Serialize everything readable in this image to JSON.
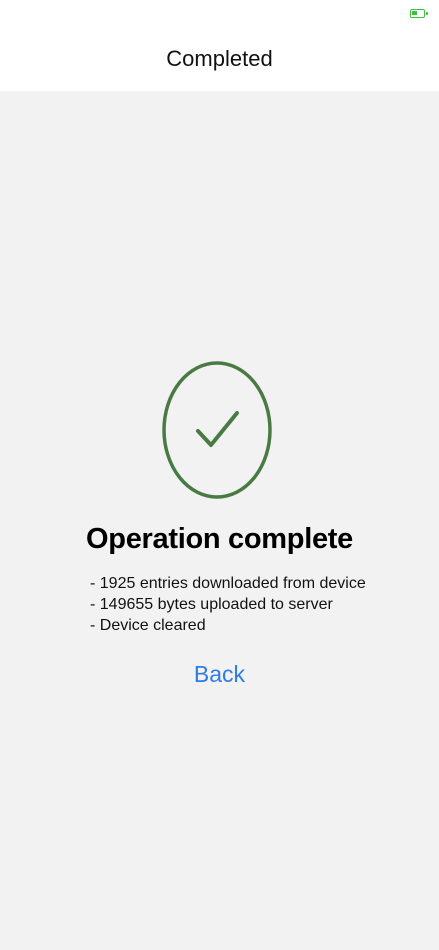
{
  "nav": {
    "title": "Completed"
  },
  "status": {
    "icon": "battery-icon",
    "battery_color": "#3cc13b"
  },
  "result": {
    "icon": "checkmark-circle-icon",
    "accent_color": "#4a7a44",
    "heading": "Operation complete",
    "details": [
      "- 1925 entries downloaded from device",
      "- 149655 bytes uploaded to server",
      "- Device cleared"
    ]
  },
  "actions": {
    "back_label": "Back",
    "back_color": "#2f7ae5"
  }
}
